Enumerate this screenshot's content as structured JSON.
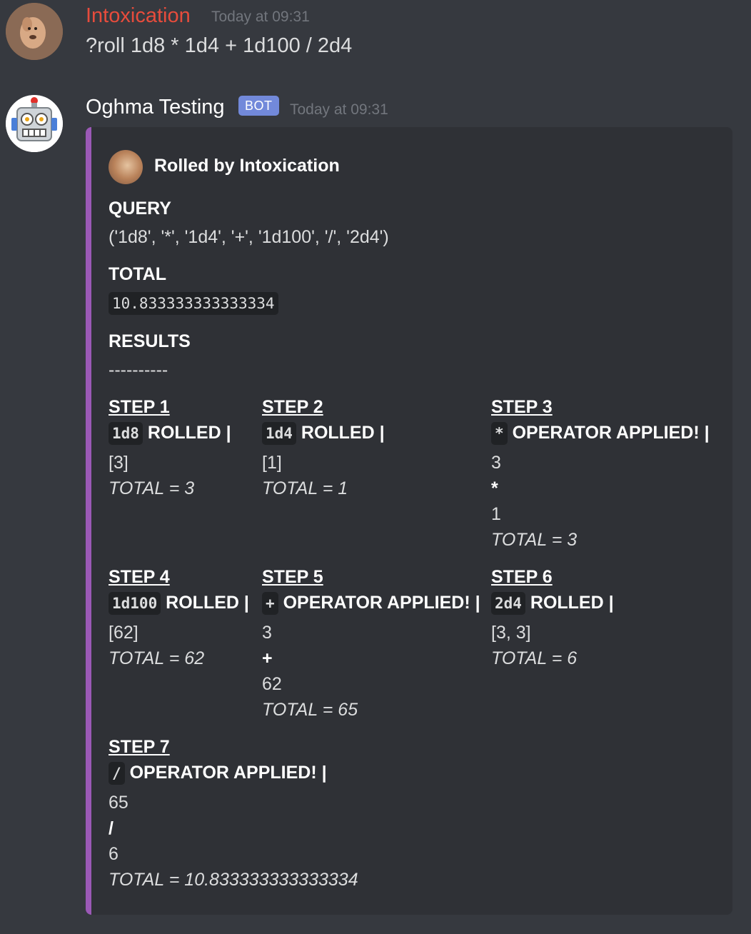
{
  "messages": [
    {
      "author": "Intoxication",
      "author_color": "#e74c3c",
      "timestamp": "Today at 09:31",
      "content": "?roll 1d8 * 1d4 + 1d100 / 2d4"
    },
    {
      "author": "Oghma Testing",
      "author_color": "#ffffff",
      "bot_tag": "BOT",
      "timestamp": "Today at 09:31",
      "embed": {
        "color": "#9b59b6",
        "author": "Rolled by Intoxication",
        "query_label": "QUERY",
        "query_value": "('1d8', '*', '1d4', '+', '1d100', '/', '2d4')",
        "total_label": "TOTAL",
        "total_value": "10.833333333333334",
        "results_label": "RESULTS",
        "results_divider": "----------",
        "steps": [
          {
            "title": "STEP 1",
            "code": "1d8",
            "label": "ROLLED |",
            "values": [
              "[3]"
            ],
            "op": "",
            "total": "TOTAL = 3"
          },
          {
            "title": "STEP 2",
            "code": "1d4",
            "label": "ROLLED |",
            "values": [
              "[1]"
            ],
            "op": "",
            "total": "TOTAL = 1"
          },
          {
            "title": "STEP 3",
            "code": "*",
            "label": "OPERATOR APPLIED! |",
            "values": [
              "3",
              "1"
            ],
            "op": "*",
            "total": "TOTAL = 3"
          },
          {
            "title": "STEP 4",
            "code": "1d100",
            "label": "ROLLED |",
            "values": [
              "[62]"
            ],
            "op": "",
            "total": "TOTAL = 62"
          },
          {
            "title": "STEP 5",
            "code": "+",
            "label": "OPERATOR APPLIED! |",
            "values": [
              "3",
              "62"
            ],
            "op": "+",
            "total": "TOTAL = 65"
          },
          {
            "title": "STEP 6",
            "code": "2d4",
            "label": "ROLLED |",
            "values": [
              "[3, 3]"
            ],
            "op": "",
            "total": "TOTAL = 6"
          },
          {
            "title": "STEP 7",
            "code": "/",
            "label": "OPERATOR APPLIED! |",
            "values": [
              "65",
              "6"
            ],
            "op": "/",
            "total": "TOTAL = 10.833333333333334"
          }
        ]
      }
    }
  ]
}
